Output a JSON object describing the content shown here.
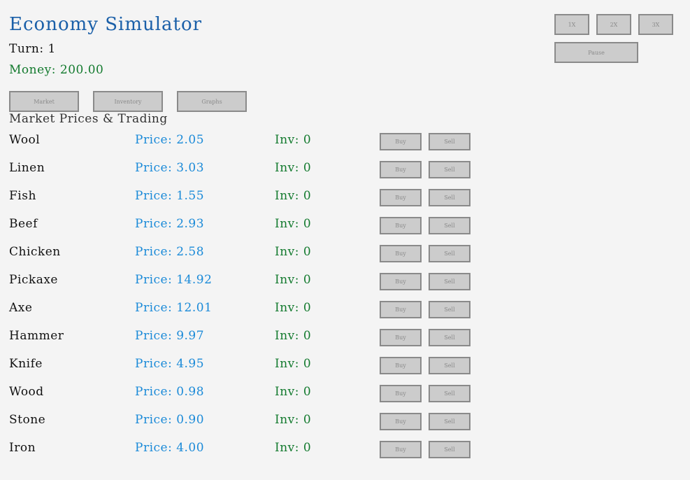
{
  "app": {
    "title": "Economy Simulator",
    "turn": "Turn: 1",
    "money": "Money: 200.00"
  },
  "speed": {
    "x1": "1X",
    "x2": "2X",
    "x3": "3X",
    "pause": "Pause"
  },
  "tabs": {
    "market": "Market",
    "inventory": "Inventory",
    "graphs": "Graphs"
  },
  "market": {
    "heading": "Market Prices & Trading",
    "buy_label": "Buy",
    "sell_label": "Sell",
    "items": [
      {
        "name": "Wool",
        "price": "Price: 2.05",
        "inv": "Inv: 0"
      },
      {
        "name": "Linen",
        "price": "Price: 3.03",
        "inv": "Inv: 0"
      },
      {
        "name": "Fish",
        "price": "Price: 1.55",
        "inv": "Inv: 0"
      },
      {
        "name": "Beef",
        "price": "Price: 2.93",
        "inv": "Inv: 0"
      },
      {
        "name": "Chicken",
        "price": "Price: 2.58",
        "inv": "Inv: 0"
      },
      {
        "name": "Pickaxe",
        "price": "Price: 14.92",
        "inv": "Inv: 0"
      },
      {
        "name": "Axe",
        "price": "Price: 12.01",
        "inv": "Inv: 0"
      },
      {
        "name": "Hammer",
        "price": "Price: 9.97",
        "inv": "Inv: 0"
      },
      {
        "name": "Knife",
        "price": "Price: 4.95",
        "inv": "Inv: 0"
      },
      {
        "name": "Wood",
        "price": "Price: 0.98",
        "inv": "Inv: 0"
      },
      {
        "name": "Stone",
        "price": "Price: 0.90",
        "inv": "Inv: 0"
      },
      {
        "name": "Iron",
        "price": "Price: 4.00",
        "inv": "Inv: 0"
      }
    ]
  },
  "colors": {
    "title": "#1a5fa8",
    "price": "#1a8ad8",
    "money": "#137a2e",
    "button_bg": "#cccccc",
    "button_border": "#8a8a8a"
  }
}
